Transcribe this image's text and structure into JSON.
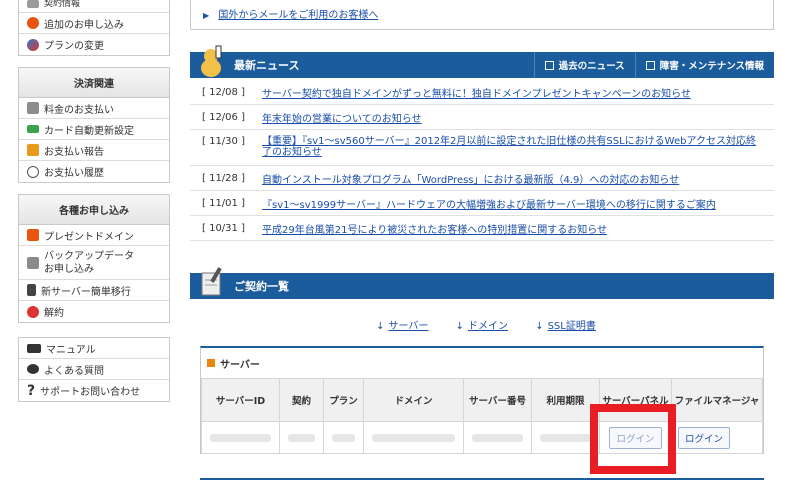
{
  "sidebar": {
    "top_items": [
      {
        "label": "契約情報",
        "icon": "contract-icon",
        "color": "#8a8a8a"
      },
      {
        "label": "追加のお申し込み",
        "icon": "add-icon",
        "color": "#e8560d"
      },
      {
        "label": "プランの変更",
        "icon": "refresh-icon",
        "color": "#2e7ac8"
      }
    ],
    "payment": {
      "heading": "決済関連",
      "items": [
        {
          "label": "料金のお支払い",
          "icon": "invoice-icon",
          "color": "#888"
        },
        {
          "label": "カード自動更新設定",
          "icon": "card-icon",
          "color": "#3aa34a"
        },
        {
          "label": "お支払い報告",
          "icon": "report-icon",
          "color": "#e89a1d"
        },
        {
          "label": "お支払い履歴",
          "icon": "clock-icon",
          "color": "#666"
        }
      ]
    },
    "apply": {
      "heading": "各種お申し込み",
      "items": [
        {
          "label": "プレゼントドメイン",
          "icon": "gift-icon",
          "color": "#e8560d"
        },
        {
          "label": "バックアップデータ\nお申し込み",
          "icon": "backup-icon",
          "color": "#777"
        },
        {
          "label": "新サーバー簡単移行",
          "icon": "server-icon",
          "color": "#444"
        },
        {
          "label": "解約",
          "icon": "cancel-icon",
          "color": "#d33"
        }
      ]
    },
    "support": [
      {
        "label": "マニュアル",
        "icon": "book-icon"
      },
      {
        "label": "よくある質問",
        "icon": "speech-bubble-icon"
      },
      {
        "label": "サポートお問い合わせ",
        "icon": "question-icon"
      }
    ]
  },
  "overseas_link": "国外からメールをご利用のお客様へ",
  "news": {
    "title": "最新ニュース",
    "past_link": "過去のニュース",
    "maintenance_link": "障害・メンテナンス情報",
    "items": [
      {
        "date": "[ 12/08 ]",
        "text": "サーバー契約で独自ドメインがずっと無料に！独自ドメインプレゼントキャンペーンのお知らせ"
      },
      {
        "date": "[ 12/06 ]",
        "text": "年末年始の営業についてのお知らせ"
      },
      {
        "date": "[ 11/30 ]",
        "text": "【重要】『sv1～sv560サーバー』2012年2月以前に設定された旧仕様の共有SSLにおけるWebアクセス対応終了のお知らせ"
      },
      {
        "date": "[ 11/28 ]",
        "text": "自動インストール対象プログラム「WordPress」における最新版（4.9）への対応のお知らせ"
      },
      {
        "date": "[ 11/01 ]",
        "text": "『sv1～sv1999サーバー』ハードウェアの大幅増強および最新サーバー環境への移行に関するご案内"
      },
      {
        "date": "[ 10/31 ]",
        "text": "平成29年台風第21号により被災されたお客様への特別措置に関するお知らせ"
      }
    ]
  },
  "contract": {
    "title": "ご契約一覧",
    "links": [
      "サーバー",
      "ドメイン",
      "SSL証明書"
    ],
    "server_heading": "サーバー",
    "columns": [
      "サーバーID",
      "契約",
      "プラン",
      "ドメイン",
      "サーバー番号",
      "利用期限",
      "サーバーパネル",
      "ファイルマネージャ"
    ],
    "login_label": "ログイン",
    "file_login_label": "ログイン"
  },
  "colors": {
    "bar": "#1b5c9c",
    "highlight": "#ea1d25",
    "link": "#1a4ea8"
  }
}
